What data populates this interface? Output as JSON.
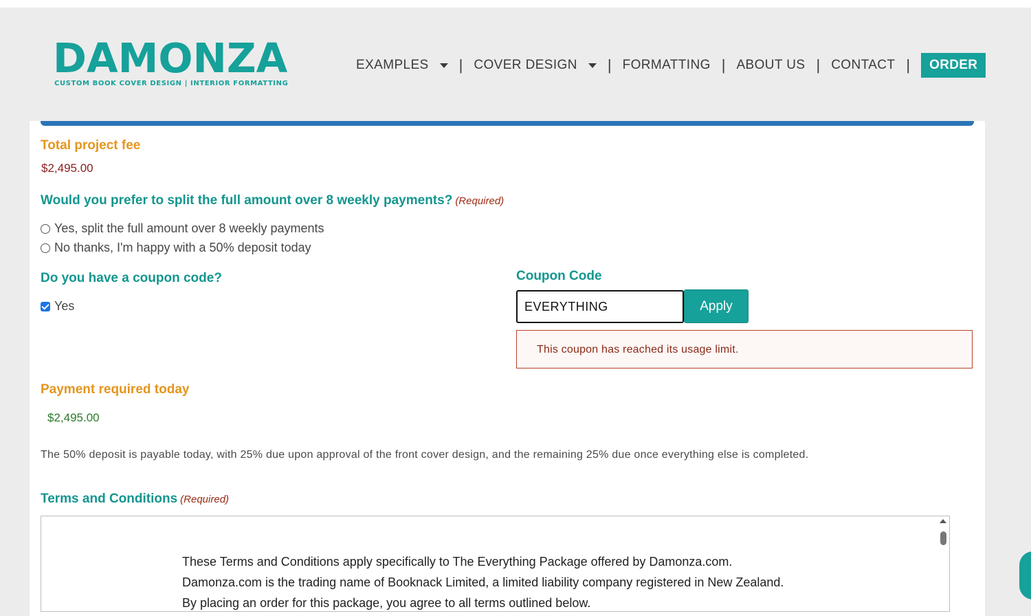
{
  "header": {
    "logo_text": "DAMONZA",
    "logo_tagline": "CUSTOM BOOK COVER DESIGN | INTERIOR FORMATTING",
    "nav": [
      {
        "label": "EXAMPLES"
      },
      {
        "label": "COVER DESIGN"
      },
      {
        "label": "FORMATTING"
      },
      {
        "label": "ABOUT US"
      },
      {
        "label": "CONTACT"
      }
    ],
    "separator": "|",
    "order_label": "ORDER"
  },
  "form": {
    "total_fee_label": "Total project fee",
    "total_fee_value": "$2,495.00",
    "split_question": "Would you prefer to split the full amount over 8 weekly payments?",
    "required_text": "(Required)",
    "split_options": [
      "Yes, split the full amount over 8 weekly payments",
      "No thanks, I'm happy with a 50% deposit today"
    ],
    "coupon_question": "Do you have a coupon code?",
    "coupon_yes_label": "Yes",
    "coupon_code_label": "Coupon Code",
    "coupon_value": "EVERYTHING",
    "apply_label": "Apply",
    "coupon_error": "This coupon has reached its usage limit.",
    "payment_today_label": "Payment required today",
    "payment_today_value": "$2,495.00",
    "deposit_note": "The 50% deposit is payable today, with 25% due upon approval of the front cover design, and the remaining 25% due once everything else is completed.",
    "terms_label": "Terms and Conditions",
    "terms_lines": [
      "These Terms and Conditions apply specifically to The Everything Package offered by Damonza.com.",
      "Damonza.com is the trading name of Booknack Limited, a limited liability company registered in New Zealand.",
      "By placing an order for this package, you agree to all terms outlined below."
    ]
  },
  "colors": {
    "brand_teal": "#16a19a",
    "label_orange": "#e6951e",
    "progress_blue": "#2a74b8",
    "error_border": "#b7432a"
  },
  "icons": [
    "chevron-down-icon",
    "radio-unchecked-icon",
    "checkbox-checked-icon",
    "scroll-up-arrow-icon",
    "chat-icon"
  ]
}
